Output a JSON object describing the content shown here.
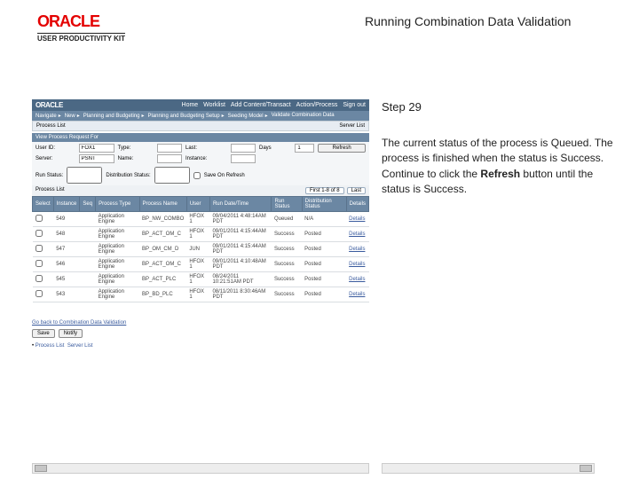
{
  "header": {
    "logo_text": "ORACLE",
    "logo_sub": "USER PRODUCTIVITY KIT",
    "page_title": "Running Combination Data Validation"
  },
  "info": {
    "step": "Step 29",
    "body_prefix": "The current status of the process is Queued. The process is finished when the status is Success. Continue to click the ",
    "body_bold": "Refresh",
    "body_suffix": " button until the status is Success."
  },
  "app": {
    "brand": "ORACLE",
    "toplinks": [
      "Home",
      "Worklist",
      "Add Content/Transact",
      "Action/Process",
      "Sign out"
    ],
    "nav": [
      "Navigate",
      "New",
      "Planning and Budgeting",
      "Planning and Budgeting Setup",
      "Seeding Model",
      "Validate Combination Data"
    ],
    "toolbar_left": "Process List",
    "toolbar_right": "Server List",
    "section_title": "View Process Request For",
    "form": {
      "user_lbl": "User ID:",
      "user_val": "FOX1",
      "type_lbl": "Type:",
      "type_val": "",
      "last_lbl": "Last:",
      "last_val": "",
      "days_lbl": "Days",
      "days_val": "1",
      "refresh": "Refresh",
      "server_lbl": "Server:",
      "server_val": "PSNT",
      "name_lbl": "Name:",
      "name_val": "",
      "instance_lbl": "Instance:",
      "instance_val": "",
      "run_lbl": "Run Status:",
      "run_val": "",
      "dist_lbl": "Distribution Status:",
      "dist_val": "",
      "save_ck": "Save On Refresh"
    },
    "tbl_ctrl": {
      "left": "Process List",
      "pager": "First 1-8 of 8",
      "last": "Last"
    },
    "columns": [
      "Select",
      "Instance",
      "Seq",
      "Process Type",
      "Process Name",
      "User",
      "Run Date/Time",
      "Run Status",
      "Distribution Status",
      "Details"
    ],
    "rows": [
      {
        "inst": "549",
        "seq": "",
        "ptype": "Application Engine",
        "pname": "BP_NW_COMBO",
        "user": "HFOX 1",
        "dt": "09/04/2011 4:48:14AM PDT",
        "run": "Queued",
        "dist": "N/A",
        "det": "Details"
      },
      {
        "inst": "548",
        "seq": "",
        "ptype": "Application Engine",
        "pname": "BP_ACT_OM_C",
        "user": "HFOX 1",
        "dt": "09/01/2011 4:15:44AM PDT",
        "run": "Success",
        "dist": "Posted",
        "det": "Details"
      },
      {
        "inst": "547",
        "seq": "",
        "ptype": "Application Engine",
        "pname": "BP_OM_CM_D",
        "user": "JUN",
        "dt": "09/01/2011 4:15:44AM PDT",
        "run": "Success",
        "dist": "Posted",
        "det": "Details"
      },
      {
        "inst": "546",
        "seq": "",
        "ptype": "Application Engine",
        "pname": "BP_ACT_OM_C",
        "user": "HFOX 1",
        "dt": "09/01/2011 4:10:48AM PDT",
        "run": "Success",
        "dist": "Posted",
        "det": "Details"
      },
      {
        "inst": "545",
        "seq": "",
        "ptype": "Application Engine",
        "pname": "BP_ACT_PLC",
        "user": "HFOX 1",
        "dt": "08/24/2011 10:21:51AM PDT",
        "run": "Success",
        "dist": "Posted",
        "det": "Details"
      },
      {
        "inst": "543",
        "seq": "",
        "ptype": "Application Engine",
        "pname": "BP_BD_PLC",
        "user": "HFOX 1",
        "dt": "08/11/2011 8:30:46AM PDT",
        "run": "Success",
        "dist": "Posted",
        "det": "Details"
      }
    ],
    "link_goback": "Go back to Combination Data Validation",
    "btn_save": "Save",
    "btn_notify": "Notify",
    "footer_left": "Process List",
    "footer_right": "Server List"
  }
}
